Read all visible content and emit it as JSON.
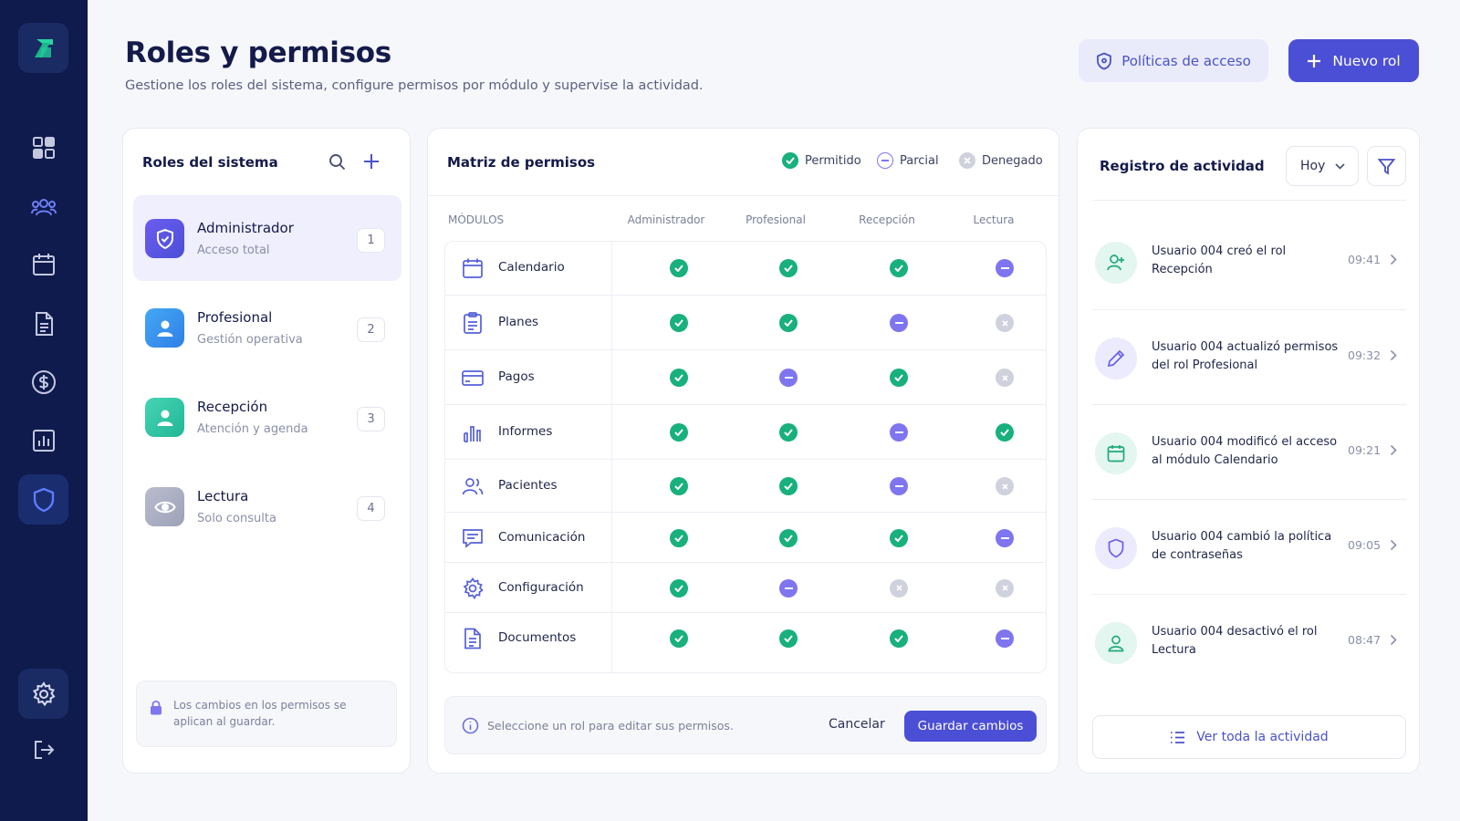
{
  "header": {
    "title": "Roles y permisos",
    "subtitle": "Gestione los roles del sistema, configure permisos por módulo y supervise la actividad.",
    "policies_label": "Políticas de acceso",
    "new_role_label": "Nuevo rol"
  },
  "colors": {
    "sidebar": "#0f1b4d",
    "accent": "#4b4fd6",
    "allowed": "#18b07c",
    "partial": "#7f75f0",
    "denied": "#cfd2dc"
  },
  "sidebar": {
    "items": [
      {
        "icon": "logo-icon"
      },
      {
        "icon": "dashboard-icon"
      },
      {
        "icon": "users-icon"
      },
      {
        "icon": "calendar-icon"
      },
      {
        "icon": "document-icon"
      },
      {
        "icon": "dollar-icon"
      },
      {
        "icon": "chart-icon"
      },
      {
        "icon": "shield-icon",
        "active": true
      },
      {
        "icon": "gear-icon"
      },
      {
        "icon": "logout-icon"
      }
    ]
  },
  "roles": {
    "title": "Roles del sistema",
    "items": [
      {
        "name": "Administrador",
        "desc": "Acceso total",
        "count": "1",
        "icon": "shield-icon",
        "selected": true
      },
      {
        "name": "Profesional",
        "desc": "Gestión operativa",
        "count": "2",
        "icon": "user-icon"
      },
      {
        "name": "Recepción",
        "desc": "Atención y agenda",
        "count": "3",
        "icon": "user-icon"
      },
      {
        "name": "Lectura",
        "desc": "Solo consulta",
        "count": "4",
        "icon": "eye-icon"
      }
    ],
    "note": "Los cambios en los permisos se aplican al guardar."
  },
  "matrix": {
    "title": "Matriz de permisos",
    "legend": {
      "allowed": "Permitido",
      "partial": "Parcial",
      "denied": "Denegado"
    },
    "columns": [
      "MÓDULOS",
      "Administrador",
      "Profesional",
      "Recepción",
      "Lectura"
    ],
    "rows": [
      {
        "module": "Calendario",
        "icon": "calendar-icon",
        "perms": [
          "allowed",
          "allowed",
          "allowed",
          "partial"
        ]
      },
      {
        "module": "Planes",
        "icon": "clipboard-icon",
        "perms": [
          "allowed",
          "allowed",
          "partial",
          "denied"
        ]
      },
      {
        "module": "Pagos",
        "icon": "credit-card-icon",
        "perms": [
          "allowed",
          "partial",
          "allowed",
          "denied"
        ]
      },
      {
        "module": "Informes",
        "icon": "bar-chart-icon",
        "perms": [
          "allowed",
          "allowed",
          "partial",
          "allowed"
        ]
      },
      {
        "module": "Pacientes",
        "icon": "users-icon",
        "perms": [
          "allowed",
          "allowed",
          "partial",
          "denied"
        ]
      },
      {
        "module": "Comunicación",
        "icon": "message-icon",
        "perms": [
          "allowed",
          "allowed",
          "allowed",
          "partial"
        ]
      },
      {
        "module": "Configuración",
        "icon": "gear-icon",
        "perms": [
          "allowed",
          "partial",
          "denied",
          "denied"
        ]
      },
      {
        "module": "Documentos",
        "icon": "document-icon",
        "perms": [
          "allowed",
          "allowed",
          "allowed",
          "partial"
        ]
      }
    ],
    "footer_hint": "Seleccione un rol para editar sus permisos.",
    "cancel_label": "Cancelar",
    "save_label": "Guardar cambios"
  },
  "activity": {
    "title": "Registro de actividad",
    "filter_value": "Hoy",
    "items": [
      {
        "text": "Usuario 004 creó el rol Recepción",
        "time": "09:41",
        "icon": "user-plus-icon"
      },
      {
        "text": "Usuario 004 actualizó permisos del rol Profesional",
        "time": "09:32",
        "icon": "pencil-icon"
      },
      {
        "text": "Usuario 004 modificó el acceso al módulo Calendario",
        "time": "09:21",
        "icon": "calendar-icon"
      },
      {
        "text": "Usuario 004 cambió la política de contraseñas",
        "time": "09:05",
        "icon": "shield-icon"
      },
      {
        "text": "Usuario 004 desactivó el rol Lectura",
        "time": "08:47",
        "icon": "user-icon"
      }
    ],
    "view_all_label": "Ver toda la actividad"
  }
}
